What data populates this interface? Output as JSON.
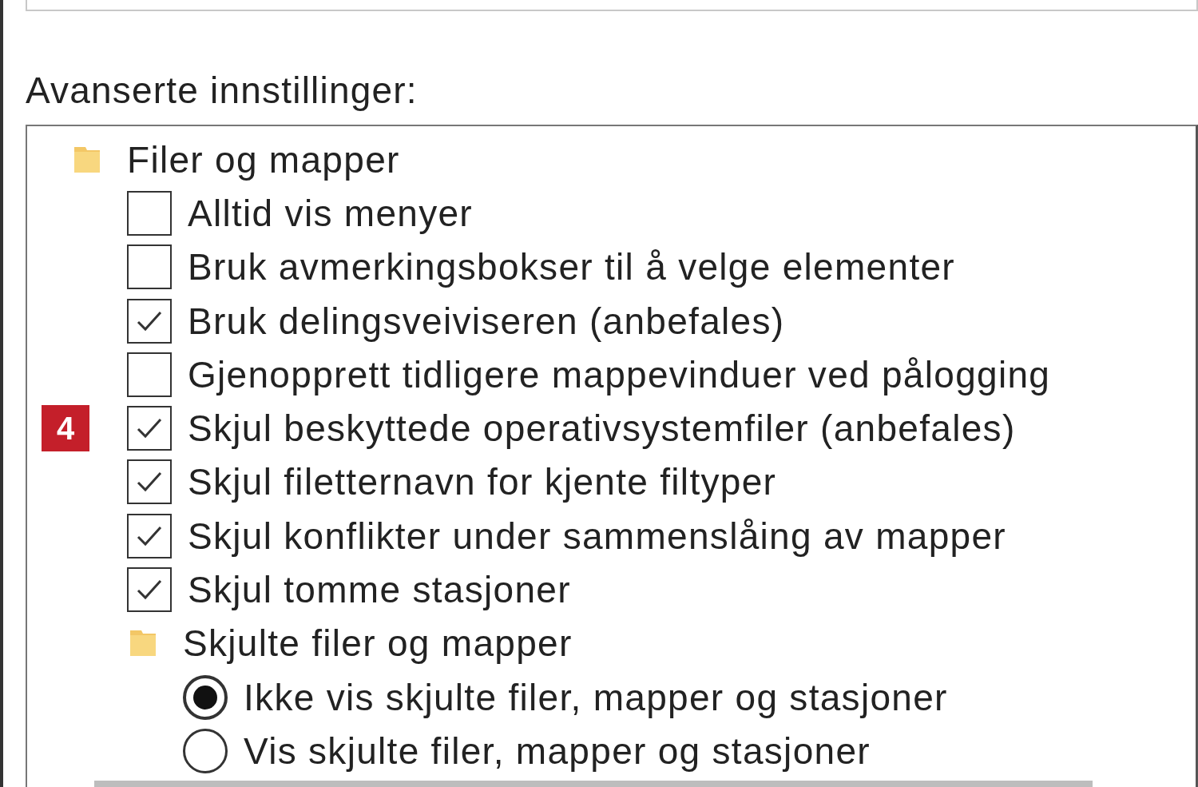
{
  "section_label": "Avanserte innstillinger:",
  "tree": [
    {
      "kind": "folder",
      "label": "Filer og mapper",
      "children": [
        {
          "kind": "checkbox",
          "label": "Alltid vis menyer",
          "checked": false
        },
        {
          "kind": "checkbox",
          "label": "Bruk avmerkingsbokser til å velge elementer",
          "checked": false
        },
        {
          "kind": "checkbox",
          "label": "Bruk delingsveiviseren (anbefales)",
          "checked": true
        },
        {
          "kind": "checkbox",
          "label": "Gjenopprett tidligere mappevinduer ved pålogging",
          "checked": false
        },
        {
          "kind": "checkbox",
          "label": "Skjul beskyttede operativsystemfiler (anbefales)",
          "checked": true,
          "badge": "4"
        },
        {
          "kind": "checkbox",
          "label": "Skjul filetternavn for kjente filtyper",
          "checked": true
        },
        {
          "kind": "checkbox",
          "label": "Skjul konflikter under sammenslåing av mapper",
          "checked": true
        },
        {
          "kind": "checkbox",
          "label": "Skjul tomme stasjoner",
          "checked": true
        },
        {
          "kind": "folder",
          "label": "Skjulte filer og mapper",
          "children": [
            {
              "kind": "radio",
              "label": "Ikke vis skjulte filer, mapper og stasjoner",
              "selected": true
            },
            {
              "kind": "radio",
              "label": "Vis skjulte filer, mapper og stasjoner",
              "selected": false
            }
          ]
        }
      ]
    }
  ]
}
